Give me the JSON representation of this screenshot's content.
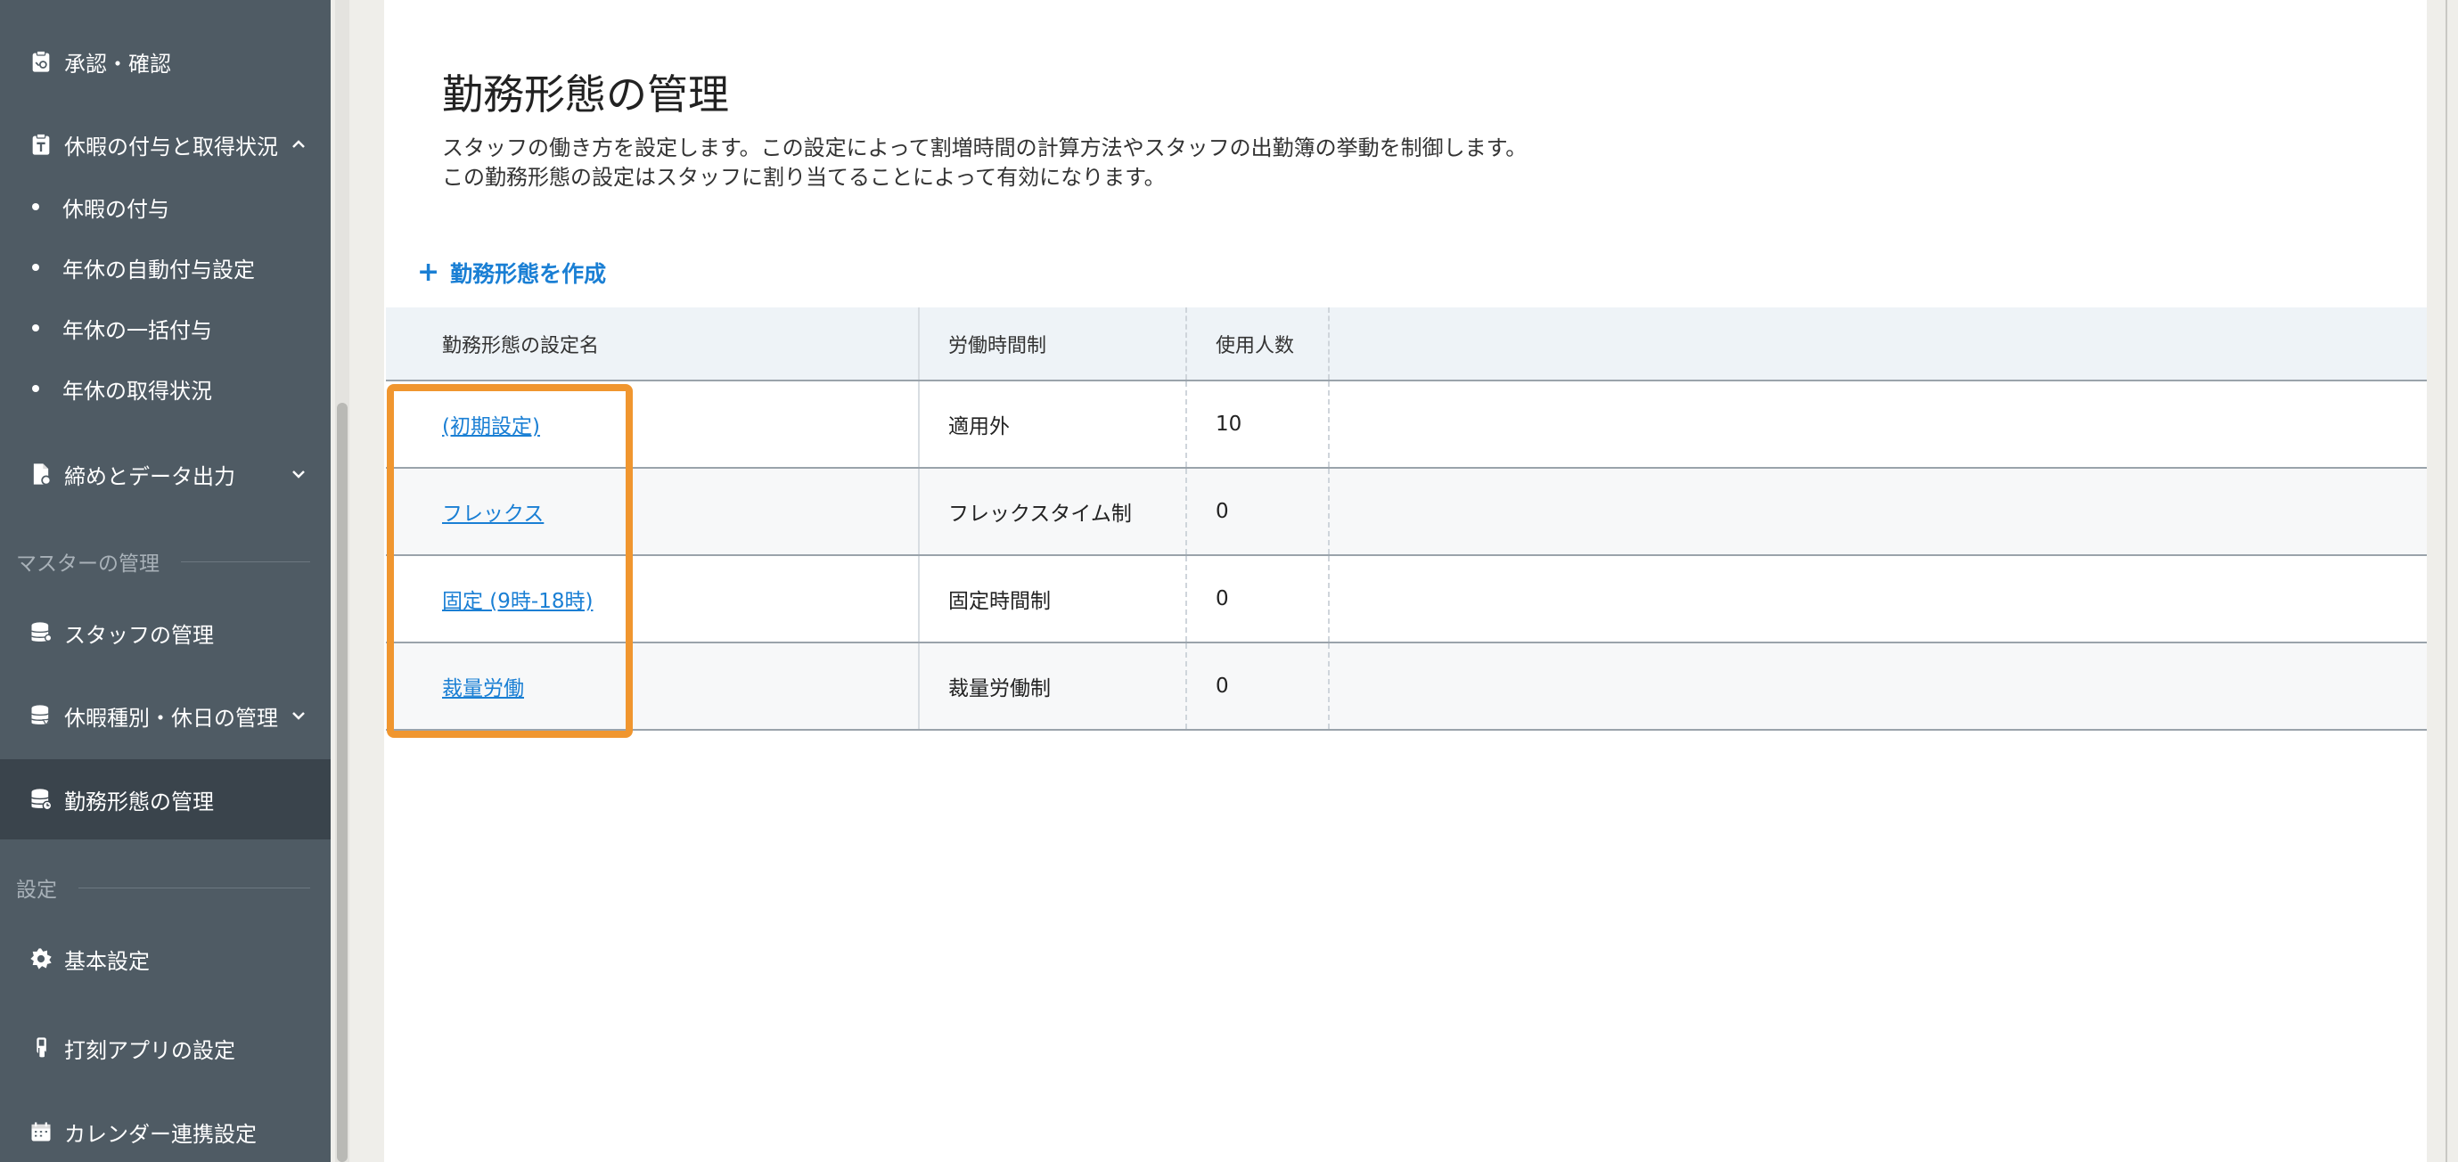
{
  "sidebar": {
    "approval": "承認・確認",
    "leave_group": "休暇の付与と取得状況",
    "leave_items": [
      "休暇の付与",
      "年休の自動付与設定",
      "年休の一括付与",
      "年休の取得状況"
    ],
    "closing": "締めとデータ出力",
    "master_section": "マスターの管理",
    "staff": "スタッフの管理",
    "leave_types": "休暇種別・休日の管理",
    "work_styles": "勤務形態の管理",
    "settings_section": "設定",
    "basic": "基本設定",
    "stamp_app": "打刻アプリの設定",
    "calendar": "カレンダー連携設定"
  },
  "page": {
    "title": "勤務形態の管理",
    "desc_line1": "スタッフの働き方を設定します。この設定によって割増時間の計算方法やスタッフの出勤簿の挙動を制御します。",
    "desc_line2": "この勤務形態の設定はスタッフに割り当てることによって有効になります。",
    "create_label": "勤務形態を作成"
  },
  "table": {
    "headers": [
      "勤務形態の設定名",
      "労働時間制",
      "使用人数"
    ],
    "rows": [
      {
        "name": "(初期設定)",
        "system": "適用外",
        "count": "10"
      },
      {
        "name": "フレックス",
        "system": "フレックスタイム制",
        "count": "0"
      },
      {
        "name": "固定 (9時-18時)",
        "system": "固定時間制",
        "count": "0"
      },
      {
        "name": "裁量労働",
        "system": "裁量労働制",
        "count": "0"
      }
    ]
  },
  "colors": {
    "sidebar_bg": "#4f5b64",
    "sidebar_active": "#3a444c",
    "link": "#1a7fd4",
    "highlight": "#f0962f"
  }
}
